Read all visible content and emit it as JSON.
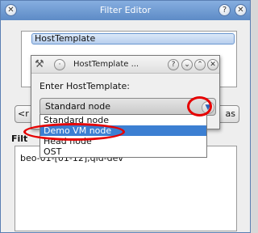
{
  "outer_window": {
    "title": "Filter Editor",
    "buttons": [
      "help-icon",
      "close-icon"
    ]
  },
  "template_list": {
    "selected_item": "HostTemplate"
  },
  "side_buttons": {
    "left_fragment": "<r",
    "right_fragment": "as"
  },
  "filter": {
    "label": "Filt",
    "text": "beo-01-[01-12],qid-dev"
  },
  "dialog": {
    "title": "HostTemplate ...",
    "prompt": "Enter HostTemplate:",
    "combo_value": "Standard node",
    "options": [
      "Standard node",
      "Demo VM node",
      "Head node",
      "OST"
    ],
    "highlighted_option": "Demo VM node"
  },
  "colors": {
    "titlebar": "#5d8bc6",
    "selection": "#3c7fd2",
    "annotation": "#e60000"
  }
}
